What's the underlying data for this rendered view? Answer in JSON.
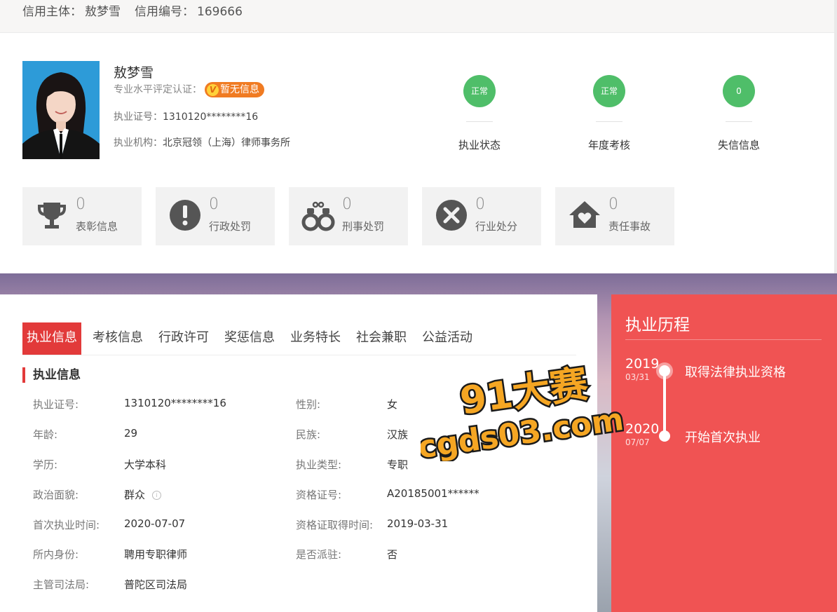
{
  "breadcrumb": {
    "subject_label": "信用主体：",
    "subject_value": "敖梦雪",
    "number_label": "信用编号：",
    "number_value": "169666"
  },
  "profile": {
    "name": "敖梦雪",
    "cert_label": "专业水平评定认证：",
    "cert_badge": "暂无信息",
    "license_label": "执业证号：",
    "license_value": "1310120********16",
    "org_label": "执业机构：",
    "org_value": "北京冠领（上海）律师事务所"
  },
  "status": [
    {
      "value": "正常",
      "label": "执业状态"
    },
    {
      "value": "正常",
      "label": "年度考核"
    },
    {
      "value": "0",
      "label": "失信信息"
    }
  ],
  "cards": [
    {
      "icon": "trophy-icon",
      "count": "0",
      "label": "表彰信息"
    },
    {
      "icon": "exclamation-icon",
      "count": "0",
      "label": "行政处罚"
    },
    {
      "icon": "handcuffs-icon",
      "count": "0",
      "label": "刑事处罚"
    },
    {
      "icon": "x-circle-icon",
      "count": "0",
      "label": "行业处分"
    },
    {
      "icon": "house-heart-icon",
      "count": "0",
      "label": "责任事故"
    }
  ],
  "tabs": [
    "执业信息",
    "考核信息",
    "行政许可",
    "奖惩信息",
    "业务特长",
    "社会兼职",
    "公益活动"
  ],
  "section_title": "执业信息",
  "fields": {
    "license": {
      "label": "执业证号:",
      "value": "1310120********16"
    },
    "gender": {
      "label": "性别:",
      "value": "女"
    },
    "age": {
      "label": "年龄:",
      "value": "29"
    },
    "ethnicity": {
      "label": "民族:",
      "value": "汉族"
    },
    "education": {
      "label": "学历:",
      "value": "大学本科"
    },
    "practice_type": {
      "label": "执业类型:",
      "value": "专职"
    },
    "political": {
      "label": "政治面貌:",
      "value": "群众"
    },
    "qualification": {
      "label": "资格证号:",
      "value": "A20185001******"
    },
    "first_practice": {
      "label": "首次执业时间:",
      "value": "2020-07-07"
    },
    "qual_date": {
      "label": "资格证取得时间:",
      "value": "2019-03-31"
    },
    "identity": {
      "label": "所内身份:",
      "value": "聘用专职律师"
    },
    "dispatched": {
      "label": "是否派驻:",
      "value": "否"
    },
    "bureau": {
      "label": "主管司法局:",
      "value": "普陀区司法局"
    }
  },
  "timeline": {
    "title": "执业历程",
    "events": [
      {
        "year": "2019",
        "date": "03/31",
        "text": "取得法律执业资格"
      },
      {
        "year": "2020",
        "date": "07/07",
        "text": "开始首次执业"
      }
    ]
  },
  "watermark": {
    "line1": "91大赛",
    "line2": "cgds03.com"
  },
  "colors": {
    "accent_red": "#e23a3a",
    "timeline_red": "#f05353",
    "status_green": "#4fbe69",
    "badge_orange": "#f07b22"
  }
}
